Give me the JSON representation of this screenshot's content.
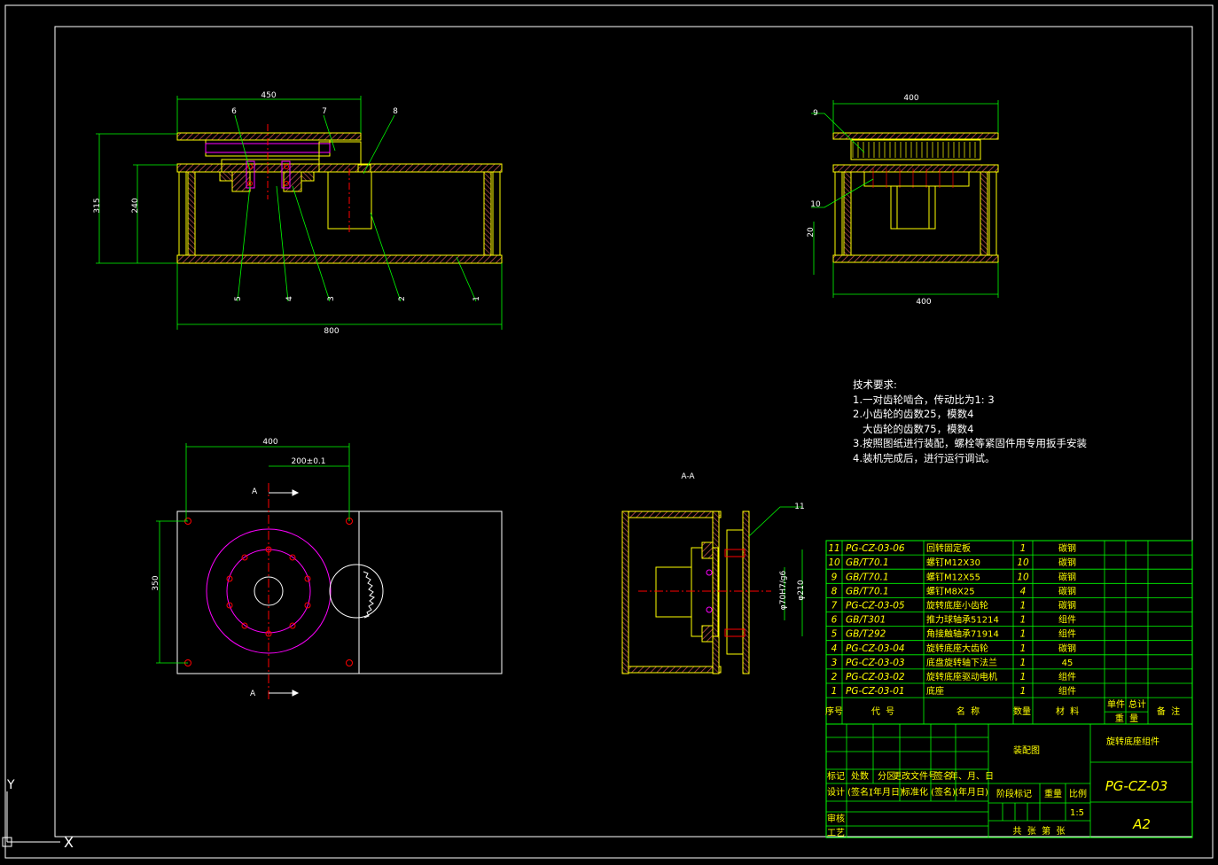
{
  "drawing": {
    "drawing_number": "PG-CZ-03",
    "assembly_name": "旋转底座组件",
    "drawing_type": "装配图",
    "sheet_size": "A2",
    "scale": "1:5"
  },
  "front_view": {
    "dims": {
      "top_width": "450",
      "height_total": "315",
      "height_inner": "240",
      "bottom_width": "800"
    },
    "balloons": [
      "1",
      "2",
      "3",
      "4",
      "5",
      "6",
      "7",
      "8"
    ]
  },
  "side_view": {
    "dims": {
      "top": "400",
      "bottom": "400",
      "small": "20"
    },
    "balloons": [
      "9",
      "10"
    ]
  },
  "plan_view": {
    "dims": {
      "width": "400",
      "offset": "200±0.1",
      "height": "350"
    },
    "section_marks": [
      "A",
      "A"
    ]
  },
  "section_view": {
    "title": "A-A",
    "balloon": "11",
    "dims": {
      "fit": "φ70H7/g6",
      "dia": "φ210"
    }
  },
  "tech_requirements": {
    "heading": "技术要求:",
    "lines": [
      "1.一对齿轮啮合，传动比为1: 3",
      "2.小齿轮的齿数25，模数4",
      "   大齿轮的齿数75，模数4",
      "3.按照图纸进行装配，螺栓等紧固件用专用扳手安装",
      "4.装机完成后，进行运行调试。"
    ]
  },
  "bom": {
    "rows": [
      {
        "no": "11",
        "code": "PG-CZ-03-06",
        "name": "回转固定板",
        "qty": "1",
        "material": "碳钢"
      },
      {
        "no": "10",
        "code": "GB/T70.1",
        "name": "螺钉M12X30",
        "qty": "10",
        "material": "碳钢"
      },
      {
        "no": "9",
        "code": "GB/T70.1",
        "name": "螺钉M12X55",
        "qty": "10",
        "material": "碳钢"
      },
      {
        "no": "8",
        "code": "GB/T70.1",
        "name": "螺钉M8X25",
        "qty": "4",
        "material": "碳钢"
      },
      {
        "no": "7",
        "code": "PG-CZ-03-05",
        "name": "旋转底座小齿轮",
        "qty": "1",
        "material": "碳钢"
      },
      {
        "no": "6",
        "code": "GB/T301",
        "name": "推力球轴承51214",
        "qty": "1",
        "material": "组件"
      },
      {
        "no": "5",
        "code": "GB/T292",
        "name": "角接触轴承71914",
        "qty": "1",
        "material": "组件"
      },
      {
        "no": "4",
        "code": "PG-CZ-03-04",
        "name": "旋转底座大齿轮",
        "qty": "1",
        "material": "碳钢"
      },
      {
        "no": "3",
        "code": "PG-CZ-03-03",
        "name": "底盘旋转轴下法兰",
        "qty": "1",
        "material": "45"
      },
      {
        "no": "2",
        "code": "PG-CZ-03-02",
        "name": "旋转底座驱动电机",
        "qty": "1",
        "material": "组件"
      },
      {
        "no": "1",
        "code": "PG-CZ-03-01",
        "name": "底座",
        "qty": "1",
        "material": "组件"
      }
    ],
    "header": {
      "no": "序号",
      "code": "代  号",
      "name": "名  称",
      "qty": "数量",
      "material": "材  料",
      "unit": "单件",
      "total": "总计",
      "weight": "重  量",
      "remark": "备  注"
    }
  },
  "title_block": {
    "row_labels": [
      "标记",
      "处数",
      "分区",
      "更改文件号",
      "签名",
      "年、月、日"
    ],
    "design": [
      "设计",
      "(签名)",
      "(年月日)",
      "标准化",
      "(签名)",
      "(年月日)"
    ],
    "stage_label": "阶段标记",
    "weight_label": "重量",
    "scale_label": "比例",
    "review": "审核",
    "process": "工艺",
    "sheets": "共  张  第  张"
  },
  "ucs": {
    "x": "X",
    "y": "Y"
  },
  "colors": {
    "background": "#000000",
    "yellow": "#ffff00",
    "green": "#00ff00",
    "red": "#ff0000",
    "magenta": "#ff00ff",
    "white": "#ffffff",
    "cyan": "#00ffff",
    "hatch": "#b04a4a"
  }
}
